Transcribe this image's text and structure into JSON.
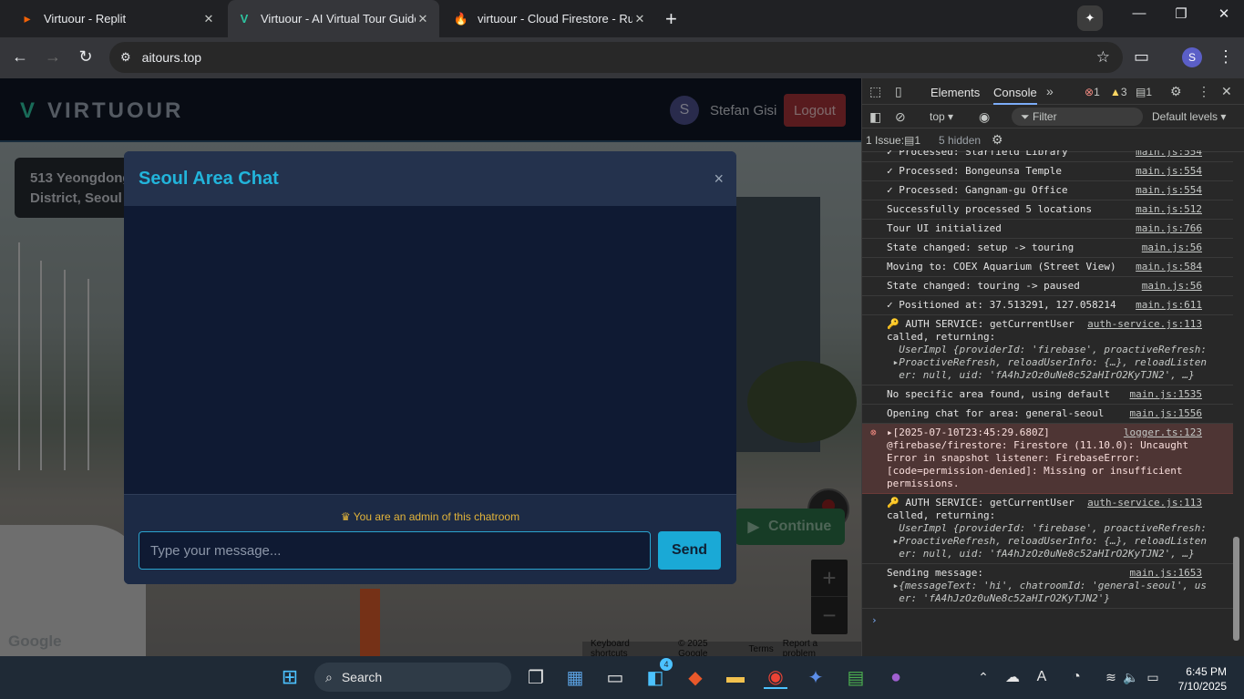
{
  "browser": {
    "tabs": [
      {
        "label": "Virtuour - Replit",
        "active": false
      },
      {
        "label": "Virtuour - AI Virtual Tour Guide",
        "active": true
      },
      {
        "label": "virtuour - Cloud Firestore - Rule",
        "active": false
      }
    ],
    "url": "aitours.top",
    "profile_initial": "S"
  },
  "app": {
    "brand": "VIRTUOUR",
    "user_initial": "S",
    "user_name": "Stefan Gisi",
    "logout_label": "Logout",
    "address": "513 Yeongdong\nDistrict, Seoul",
    "continue_label": "Continue",
    "zoom_in": "+",
    "zoom_out": "−",
    "google_logo": "Google",
    "footer": {
      "shortcuts": "Keyboard shortcuts",
      "copyright": "© 2025 Google",
      "terms": "Terms",
      "report": "Report a problem"
    }
  },
  "chat": {
    "title": "Seoul Area Chat",
    "close": "×",
    "admin_notice": "You are an admin of this chatroom",
    "input_placeholder": "Type your message...",
    "send_label": "Send"
  },
  "devtools": {
    "tabs": [
      "Elements",
      "Console"
    ],
    "errors": "1",
    "warnings": "3",
    "messages": "1",
    "context": "top",
    "filter_placeholder": "Filter",
    "levels": "Default levels",
    "issues_label": "1 Issue:",
    "issues_count": "1",
    "hidden": "5 hidden",
    "logs": [
      {
        "text": "✓ Processed: Starfield Library",
        "src": "main.js:554"
      },
      {
        "text": "✓ Processed: Bongeunsa Temple",
        "src": "main.js:554"
      },
      {
        "text": "✓ Processed: Gangnam-gu Office",
        "src": "main.js:554"
      },
      {
        "text": "Successfully processed 5 locations",
        "src": "main.js:512"
      },
      {
        "text": "Tour UI initialized",
        "src": "main.js:766"
      },
      {
        "text": "State changed: setup -> touring",
        "src": "main.js:56"
      },
      {
        "text": "Moving to: COEX Aquarium (Street View)",
        "src": "main.js:584"
      },
      {
        "text": "State changed: touring -> paused",
        "src": "main.js:56"
      },
      {
        "text": "✓ Positioned at: 37.513291, 127.058214",
        "src": "main.js:611"
      },
      {
        "text": "🔑 AUTH SERVICE: getCurrentUser\ncalled, returning:",
        "src": "auth-service.js:113",
        "obj": "  UserImpl {providerId: 'firebase', proactiveRefresh:\n ▸ProactiveRefresh, reloadUserInfo: {…}, reloadListen\n  er: null, uid: 'fA4hJzOz0uNe8c52aHIrO2KyTJN2', …}"
      },
      {
        "text": "No specific area found, using default",
        "src": "main.js:1535"
      },
      {
        "text": "Opening chat for area: general-seoul",
        "src": "main.js:1556"
      },
      {
        "text": "▸[2025-07-10T23:45:29.680Z]\n@firebase/firestore: Firestore (11.10.0): Uncaught\nError in snapshot listener: FirebaseError:\n[code=permission-denied]: Missing or insufficient\npermissions.",
        "src": "logger.ts:123",
        "error": true
      },
      {
        "text": "🔑 AUTH SERVICE: getCurrentUser\ncalled, returning:",
        "src": "auth-service.js:113",
        "obj": "  UserImpl {providerId: 'firebase', proactiveRefresh:\n ▸ProactiveRefresh, reloadUserInfo: {…}, reloadListen\n  er: null, uid: 'fA4hJzOz0uNe8c52aHIrO2KyTJN2', …}"
      },
      {
        "text": "Sending message:",
        "src": "main.js:1653",
        "obj": " ▸{messageText: 'hi', chatroomId: 'general-seoul', us\n  er: 'fA4hJzOz0uNe8c52aHIrO2KyTJN2'}"
      }
    ]
  },
  "taskbar": {
    "search": "Search",
    "badge": "4",
    "time": "6:45 PM",
    "date": "7/10/2025"
  }
}
